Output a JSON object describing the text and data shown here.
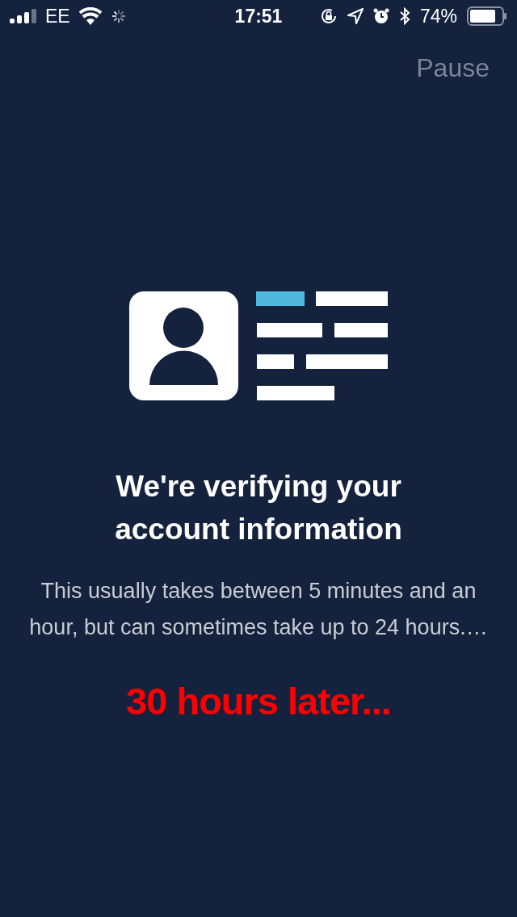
{
  "status_bar": {
    "carrier": "EE",
    "time": "17:51",
    "battery": "74%"
  },
  "pause_button": "Pause",
  "title": "We're verifying your account information",
  "message": "This usually takes between 5 minutes and an hour, but can sometimes take up to 24 hours.…",
  "caption": "30 hours later..."
}
